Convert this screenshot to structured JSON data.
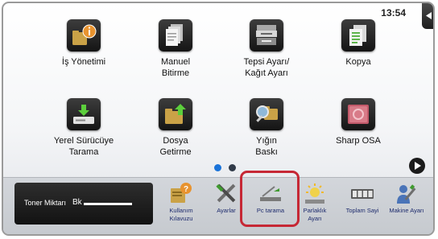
{
  "status_bar": {
    "time": "13:54"
  },
  "icons": {
    "side_tab": "triangle-left-icon",
    "next": "play-right-icon"
  },
  "home": {
    "tiles": [
      {
        "label": "İş Yönetimi",
        "icon": "job-status-icon"
      },
      {
        "label": "Manuel Bitirme",
        "icon": "manual-finish-icon"
      },
      {
        "label": "Tepsi Ayarı/ Kağıt Ayarı",
        "icon": "tray-settings-icon"
      },
      {
        "label": "Kopya",
        "icon": "copy-icon"
      },
      {
        "label": "Yerel Sürücüye Tarama",
        "icon": "scan-to-local-drive-icon"
      },
      {
        "label": "Dosya Getirme",
        "icon": "file-retrieve-icon"
      },
      {
        "label": "Yığın Baskı",
        "icon": "bulk-print-icon"
      },
      {
        "label": "Sharp OSA",
        "icon": "sharp-osa-icon"
      }
    ],
    "page_dots": {
      "count": 2,
      "active_index": 0
    }
  },
  "bottom_bar": {
    "toner": {
      "label": "Toner Miktarı",
      "color": "Bk"
    },
    "buttons": [
      {
        "label": "Kullanım Kılavuzu",
        "icon": "help-manual-icon"
      },
      {
        "label": "Ayarlar",
        "icon": "tools-icon"
      },
      {
        "label": "Pc tarama",
        "icon": "pc-scan-icon"
      },
      {
        "label": "Parlaklık Ayarı",
        "icon": "brightness-icon"
      },
      {
        "label": "Toplam Sayi",
        "icon": "total-count-icon"
      },
      {
        "label": "Makine Ayarı",
        "icon": "machine-settings-icon"
      }
    ]
  },
  "colors": {
    "accent": "#1a73d9",
    "highlight": "#c62835",
    "tile_background": "#1f1f1f"
  }
}
